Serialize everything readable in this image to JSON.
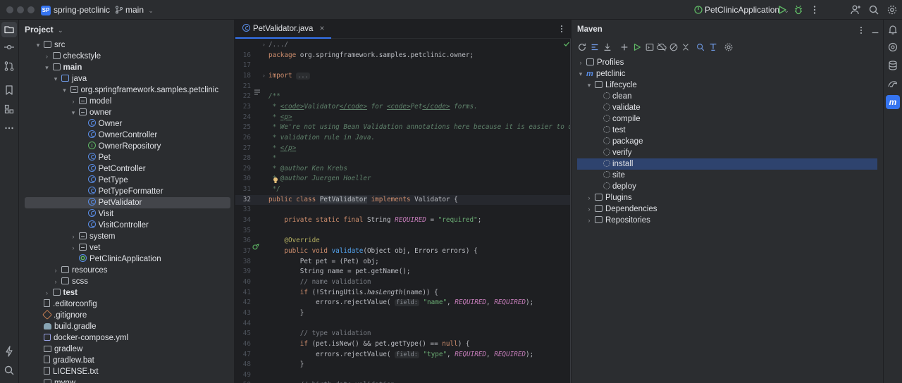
{
  "titlebar": {
    "project_badge": "SP",
    "project_name": "spring-petclinic",
    "branch": "main",
    "run_config": "PetClinicApplication"
  },
  "project_panel": {
    "title": "Project",
    "tree": [
      {
        "label": "src",
        "depth": 0,
        "arrow": "▾",
        "icon": "folder"
      },
      {
        "label": "checkstyle",
        "depth": 1,
        "arrow": "›",
        "icon": "folder"
      },
      {
        "label": "main",
        "depth": 1,
        "arrow": "▾",
        "icon": "folder",
        "bold": true
      },
      {
        "label": "java",
        "depth": 2,
        "arrow": "▾",
        "icon": "folder-blue"
      },
      {
        "label": "org.springframework.samples.petclinic",
        "depth": 3,
        "arrow": "▾",
        "icon": "pkg"
      },
      {
        "label": "model",
        "depth": 4,
        "arrow": "›",
        "icon": "pkg"
      },
      {
        "label": "owner",
        "depth": 4,
        "arrow": "▾",
        "icon": "pkg"
      },
      {
        "label": "Owner",
        "depth": 5,
        "arrow": "",
        "icon": "class"
      },
      {
        "label": "OwnerController",
        "depth": 5,
        "arrow": "",
        "icon": "class"
      },
      {
        "label": "OwnerRepository",
        "depth": 5,
        "arrow": "",
        "icon": "iface"
      },
      {
        "label": "Pet",
        "depth": 5,
        "arrow": "",
        "icon": "class"
      },
      {
        "label": "PetController",
        "depth": 5,
        "arrow": "",
        "icon": "class"
      },
      {
        "label": "PetType",
        "depth": 5,
        "arrow": "",
        "icon": "class"
      },
      {
        "label": "PetTypeFormatter",
        "depth": 5,
        "arrow": "",
        "icon": "class"
      },
      {
        "label": "PetValidator",
        "depth": 5,
        "arrow": "",
        "icon": "class",
        "selected": true
      },
      {
        "label": "Visit",
        "depth": 5,
        "arrow": "",
        "icon": "class"
      },
      {
        "label": "VisitController",
        "depth": 5,
        "arrow": "",
        "icon": "class"
      },
      {
        "label": "system",
        "depth": 4,
        "arrow": "›",
        "icon": "pkg"
      },
      {
        "label": "vet",
        "depth": 4,
        "arrow": "›",
        "icon": "pkg"
      },
      {
        "label": "PetClinicApplication",
        "depth": 4,
        "arrow": "",
        "icon": "spring"
      },
      {
        "label": "resources",
        "depth": 2,
        "arrow": "›",
        "icon": "folder"
      },
      {
        "label": "scss",
        "depth": 2,
        "arrow": "›",
        "icon": "folder"
      },
      {
        "label": "test",
        "depth": 1,
        "arrow": "›",
        "icon": "folder",
        "bold": true
      },
      {
        "label": ".editorconfig",
        "depth": 0,
        "arrow": "",
        "icon": "file"
      },
      {
        "label": ".gitignore",
        "depth": 0,
        "arrow": "",
        "icon": "git"
      },
      {
        "label": "build.gradle",
        "depth": 0,
        "arrow": "",
        "icon": "gradle"
      },
      {
        "label": "docker-compose.yml",
        "depth": 0,
        "arrow": "",
        "icon": "yaml"
      },
      {
        "label": "gradlew",
        "depth": 0,
        "arrow": "",
        "icon": "term"
      },
      {
        "label": "gradlew.bat",
        "depth": 0,
        "arrow": "",
        "icon": "file"
      },
      {
        "label": "LICENSE.txt",
        "depth": 0,
        "arrow": "",
        "icon": "file"
      },
      {
        "label": "mvnw",
        "depth": 0,
        "arrow": "",
        "icon": "term"
      }
    ]
  },
  "editor": {
    "tab_label": "PetValidator.java",
    "tab_close": "×",
    "lines": [
      {
        "n": "",
        "html": "<span class=\"cmt\">/.../</span>"
      },
      {
        "n": "16",
        "html": "<span class=\"kw\">package</span> org.springframework.samples.petclinic.owner;"
      },
      {
        "n": "17",
        "html": ""
      },
      {
        "n": "18",
        "html": "<span class=\"kw\">import</span> <span class=\"hint\">...</span>"
      },
      {
        "n": "21",
        "html": ""
      },
      {
        "n": "22",
        "html": "<span class=\"doc\">/**</span>"
      },
      {
        "n": "23",
        "html": "<span class=\"doc\"> * </span><span class=\"tag\">&lt;code&gt;</span><span class=\"doc\">Validator</span><span class=\"tag\">&lt;/code&gt;</span><span class=\"doc\"> for </span><span class=\"tag\">&lt;code&gt;</span><span class=\"doc\">Pet</span><span class=\"tag\">&lt;/code&gt;</span><span class=\"doc\"> forms.</span>"
      },
      {
        "n": "24",
        "html": "<span class=\"doc\"> * </span><span class=\"tag\">&lt;p&gt;</span>"
      },
      {
        "n": "25",
        "html": "<span class=\"doc\"> * We're not using Bean Validation annotations here because it is easier to define such</span>"
      },
      {
        "n": "26",
        "html": "<span class=\"doc\"> * validation rule in Java.</span>"
      },
      {
        "n": "27",
        "html": "<span class=\"doc\"> * </span><span class=\"tag\">&lt;/p&gt;</span>"
      },
      {
        "n": "28",
        "html": "<span class=\"doc\"> *</span>"
      },
      {
        "n": "29",
        "html": "<span class=\"doc\"> * @author Ken Krebs</span>"
      },
      {
        "n": "30",
        "html": "<span class=\"doc\"> * @author Juergen Hoeller</span>"
      },
      {
        "n": "31",
        "html": "<span class=\"doc\"> */</span>"
      },
      {
        "n": "32",
        "html": "<span class=\"kw\">public class</span> <span class=\"hl-name\">PetValidator</span> <span class=\"kw\">implements</span> Validator {"
      },
      {
        "n": "33",
        "html": ""
      },
      {
        "n": "34",
        "html": "    <span class=\"kw\">private static final</span> String <span class=\"const\">REQUIRED</span> = <span class=\"str\">\"required\"</span>;"
      },
      {
        "n": "35",
        "html": ""
      },
      {
        "n": "36",
        "html": "    <span class=\"ann\">@Override</span>"
      },
      {
        "n": "37",
        "html": "    <span class=\"kw\">public void</span> <span class=\"meth\">validate</span>(Object obj, Errors errors) {"
      },
      {
        "n": "38",
        "html": "        Pet pet = (Pet) obj;"
      },
      {
        "n": "39",
        "html": "        String name = pet.getName();"
      },
      {
        "n": "40",
        "html": "        <span class=\"cmt\">// name validation</span>"
      },
      {
        "n": "41",
        "html": "        <span class=\"kw\">if</span> (!StringUtils.<i>hasLength</i>(name)) {"
      },
      {
        "n": "42",
        "html": "            errors.rejectValue( <span class=\"hint\">field:</span> <span class=\"str\">\"name\"</span>, <span class=\"const\">REQUIRED</span>, <span class=\"const\">REQUIRED</span>);"
      },
      {
        "n": "43",
        "html": "        }"
      },
      {
        "n": "44",
        "html": ""
      },
      {
        "n": "45",
        "html": "        <span class=\"cmt\">// type validation</span>"
      },
      {
        "n": "46",
        "html": "        <span class=\"kw\">if</span> (pet.isNew() && pet.getType() == <span class=\"kw\">null</span>) {"
      },
      {
        "n": "47",
        "html": "            errors.rejectValue( <span class=\"hint\">field:</span> <span class=\"str\">\"type\"</span>, <span class=\"const\">REQUIRED</span>, <span class=\"const\">REQUIRED</span>);"
      },
      {
        "n": "48",
        "html": "        }"
      },
      {
        "n": "49",
        "html": ""
      },
      {
        "n": "50",
        "html": "        <span class=\"cmt\">// birth date validation</span>"
      }
    ]
  },
  "maven_panel": {
    "title": "Maven",
    "tree": [
      {
        "label": "Profiles",
        "depth": 0,
        "arrow": "›",
        "icon": "folder"
      },
      {
        "label": "petclinic",
        "depth": 0,
        "arrow": "▾",
        "icon": "maven"
      },
      {
        "label": "Lifecycle",
        "depth": 1,
        "arrow": "▾",
        "icon": "folder"
      },
      {
        "label": "clean",
        "depth": 2,
        "arrow": "",
        "icon": "gear"
      },
      {
        "label": "validate",
        "depth": 2,
        "arrow": "",
        "icon": "gear"
      },
      {
        "label": "compile",
        "depth": 2,
        "arrow": "",
        "icon": "gear"
      },
      {
        "label": "test",
        "depth": 2,
        "arrow": "",
        "icon": "gear"
      },
      {
        "label": "package",
        "depth": 2,
        "arrow": "",
        "icon": "gear"
      },
      {
        "label": "verify",
        "depth": 2,
        "arrow": "",
        "icon": "gear"
      },
      {
        "label": "install",
        "depth": 2,
        "arrow": "",
        "icon": "gear",
        "selected": true
      },
      {
        "label": "site",
        "depth": 2,
        "arrow": "",
        "icon": "gear"
      },
      {
        "label": "deploy",
        "depth": 2,
        "arrow": "",
        "icon": "gear"
      },
      {
        "label": "Plugins",
        "depth": 1,
        "arrow": "›",
        "icon": "folder"
      },
      {
        "label": "Dependencies",
        "depth": 1,
        "arrow": "›",
        "icon": "folder"
      },
      {
        "label": "Repositories",
        "depth": 1,
        "arrow": "›",
        "icon": "folder"
      }
    ]
  },
  "right_strip": {
    "maven_badge": "m"
  },
  "colors": {
    "accent": "#3574f0",
    "selection": "#2e436e",
    "background": "#1e1f22",
    "panel": "#2b2d30"
  }
}
